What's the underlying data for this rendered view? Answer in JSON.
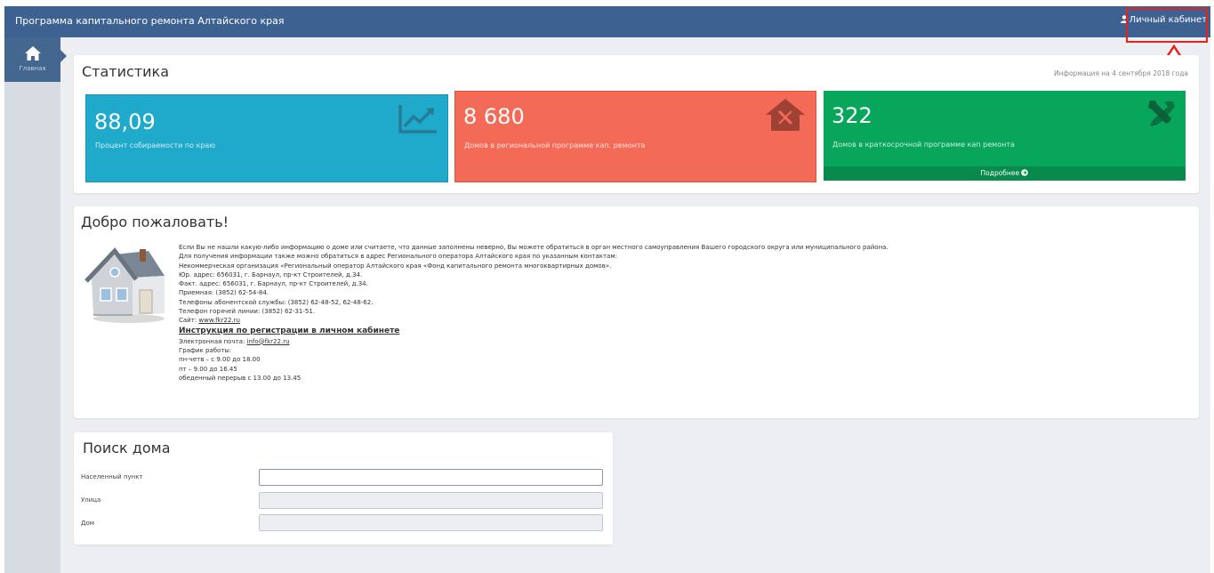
{
  "header": {
    "title": "Программа капитального ремонта Алтайского края",
    "cabinet_label": "Личный кабинет"
  },
  "sidebar": {
    "items": [
      {
        "label": "Главная",
        "icon": "home-icon"
      }
    ]
  },
  "stats": {
    "title": "Статистика",
    "info_date": "Информация на 4 сентября 2018 года",
    "tiles": [
      {
        "value": "88,09",
        "label": "Процент собираемости по краю",
        "icon": "trending-up-icon",
        "color": "#1fa9cb"
      },
      {
        "value": "8 680",
        "label": "Домов в региональной программе кап. ремонта",
        "icon": "house-repair-icon",
        "color": "#f36a57"
      },
      {
        "value": "322",
        "label": "Домов в краткосрочной программе кап ремонта",
        "icon": "tools-icon",
        "color": "#08a65b",
        "more": "Подробнее"
      }
    ]
  },
  "welcome": {
    "title": "Добро пожаловать!",
    "lines": [
      "Если Вы не нашли какую-либо информацию о доме или считаете, что данные заполнены неверно, Вы можете обратиться в орган местного самоуправления Вашего городского округа или муниципального района.",
      "Для получения информации также можно обратиться в адрес Регионального оператора Алтайского края по указанным контактам:",
      "Некоммерческая организация «Региональный оператор Алтайского края «Фонд капитального ремонта многоквартирных домов».",
      "Юр. адрес: 656031, г. Барнаул, пр-кт Строителей, д.34.",
      "Факт. адрес: 656031, г. Барнаул, пр-кт Строителей, д.34.",
      "Приемная: (3852) 62-54-84.",
      "Телефоны абонентской службы: (3852) 62-48-52, 62-48-62.",
      "Телефон горячей линии: (3852) 62-31-51."
    ],
    "site_label": "Сайт: ",
    "site_link": "www.fkr22.ru",
    "instruction_link": "Инструкция по регистрации в личном кабинете",
    "email_label": "Электронная почта: ",
    "email_link": "info@fkr22.ru",
    "schedule": [
      "График работы:",
      "пн-четв – с 9.00 до 18.00",
      "пт – 9.00 до 16.45",
      "обеденный перерыв с 13.00 до 13.45"
    ]
  },
  "search": {
    "title": "Поиск дома",
    "fields": [
      {
        "label": "Населенный пункт",
        "value": ""
      },
      {
        "label": "Улица",
        "value": ""
      },
      {
        "label": "Дом",
        "value": ""
      }
    ]
  },
  "colors": {
    "header": "#3d6291",
    "annotation": "#e8211c"
  }
}
